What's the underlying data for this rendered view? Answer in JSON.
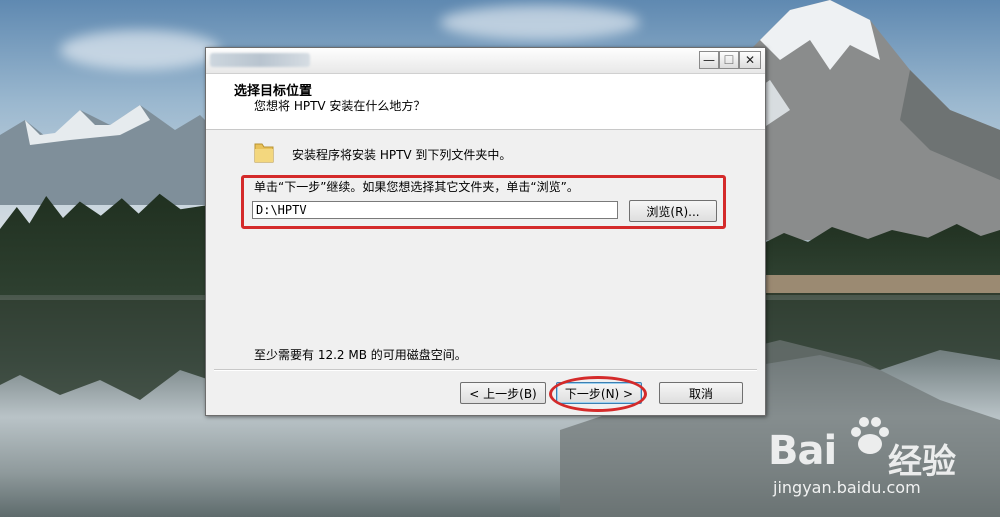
{
  "dialog": {
    "header_title": "选择目标位置",
    "header_subtitle": "您想将 HPTV 安装在什么地方？",
    "install_line": "安装程序将安装 HPTV 到下列文件夹中。",
    "instruction_line": "单击“下一步”继续。如果您想选择其它文件夹，单击“浏览”。",
    "path_value": "D:\\HPTV",
    "browse_label": "浏览(R)...",
    "space_text": "至少需要有 12.2 MB 的可用磁盘空间。",
    "back_label": "< 上一步(B)",
    "next_label": "下一步(N) >",
    "cancel_label": "取消",
    "window_buttons": {
      "minimize": "—",
      "maximize": "☐",
      "close": "✕"
    }
  },
  "watermark": {
    "logo_text": "Bai",
    "logo_text2": "经验",
    "url": "jingyan.baidu.com"
  },
  "colors": {
    "annotation_red": "#d42a2a",
    "dialog_bg": "#f0f0f0"
  }
}
